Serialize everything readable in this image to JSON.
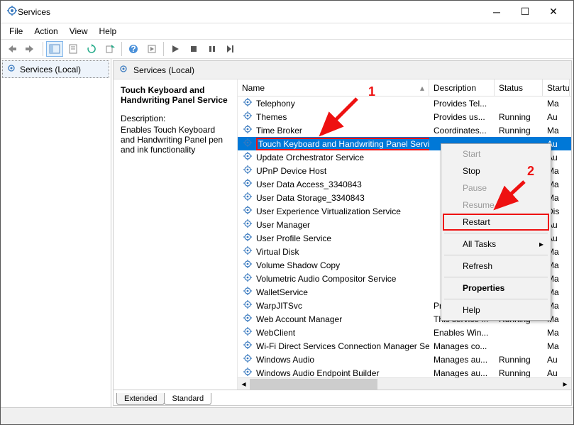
{
  "window": {
    "title": "Services"
  },
  "menus": [
    "File",
    "Action",
    "View",
    "Help"
  ],
  "tree": {
    "root": "Services (Local)"
  },
  "right_header": "Services (Local)",
  "detail": {
    "name": "Touch Keyboard and Handwriting Panel Service",
    "desc_label": "Description:",
    "desc": "Enables Touch Keyboard and Handwriting Panel pen and ink functionality"
  },
  "columns": {
    "name": "Name",
    "desc": "Description",
    "status": "Status",
    "startup": "Startup Type"
  },
  "col_sort_indicator": "▴",
  "services": [
    {
      "name": "Telephony",
      "desc": "Provides Tel...",
      "status": "",
      "startup": "Ma"
    },
    {
      "name": "Themes",
      "desc": "Provides us...",
      "status": "Running",
      "startup": "Au"
    },
    {
      "name": "Time Broker",
      "desc": "Coordinates...",
      "status": "Running",
      "startup": "Ma"
    },
    {
      "name": "Touch Keyboard and Handwriting Panel Service",
      "desc": "",
      "status": "",
      "startup": "Au",
      "selected": true
    },
    {
      "name": "Update Orchestrator Service",
      "desc": "",
      "status": "",
      "startup": "Au"
    },
    {
      "name": "UPnP Device Host",
      "desc": "",
      "status": "",
      "startup": "Ma"
    },
    {
      "name": "User Data Access_3340843",
      "desc": "",
      "status": "",
      "startup": "Ma"
    },
    {
      "name": "User Data Storage_3340843",
      "desc": "",
      "status": "",
      "startup": "Ma"
    },
    {
      "name": "User Experience Virtualization Service",
      "desc": "",
      "status": "",
      "startup": "Dis"
    },
    {
      "name": "User Manager",
      "desc": "",
      "status": "",
      "startup": "Au"
    },
    {
      "name": "User Profile Service",
      "desc": "",
      "status": "",
      "startup": "Au"
    },
    {
      "name": "Virtual Disk",
      "desc": "",
      "status": "",
      "startup": "Ma"
    },
    {
      "name": "Volume Shadow Copy",
      "desc": "",
      "status": "",
      "startup": "Ma"
    },
    {
      "name": "Volumetric Audio Compositor Service",
      "desc": "",
      "status": "",
      "startup": "Ma"
    },
    {
      "name": "WalletService",
      "desc": "",
      "status": "",
      "startup": "Ma"
    },
    {
      "name": "WarpJITSvc",
      "desc": "Provides a J...",
      "status": "",
      "startup": "Ma"
    },
    {
      "name": "Web Account Manager",
      "desc": "This service ...",
      "status": "Running",
      "startup": "Ma"
    },
    {
      "name": "WebClient",
      "desc": "Enables Win...",
      "status": "",
      "startup": "Ma"
    },
    {
      "name": "Wi-Fi Direct Services Connection Manager Ser...",
      "desc": "Manages co...",
      "status": "",
      "startup": "Ma"
    },
    {
      "name": "Windows Audio",
      "desc": "Manages au...",
      "status": "Running",
      "startup": "Au"
    },
    {
      "name": "Windows Audio Endpoint Builder",
      "desc": "Manages au...",
      "status": "Running",
      "startup": "Au"
    }
  ],
  "context_menu": {
    "items": [
      {
        "label": "Start",
        "disabled": true
      },
      {
        "label": "Stop"
      },
      {
        "label": "Pause",
        "disabled": true
      },
      {
        "label": "Resume",
        "disabled": true
      },
      {
        "label": "Restart",
        "highlight": true
      },
      {
        "sep": true
      },
      {
        "label": "All Tasks",
        "submenu": true
      },
      {
        "sep": true
      },
      {
        "label": "Refresh"
      },
      {
        "sep": true
      },
      {
        "label": "Properties",
        "bold": true
      },
      {
        "sep": true
      },
      {
        "label": "Help"
      }
    ]
  },
  "tabs": {
    "extended": "Extended",
    "standard": "Standard"
  },
  "annotations": {
    "one": "1",
    "two": "2"
  }
}
